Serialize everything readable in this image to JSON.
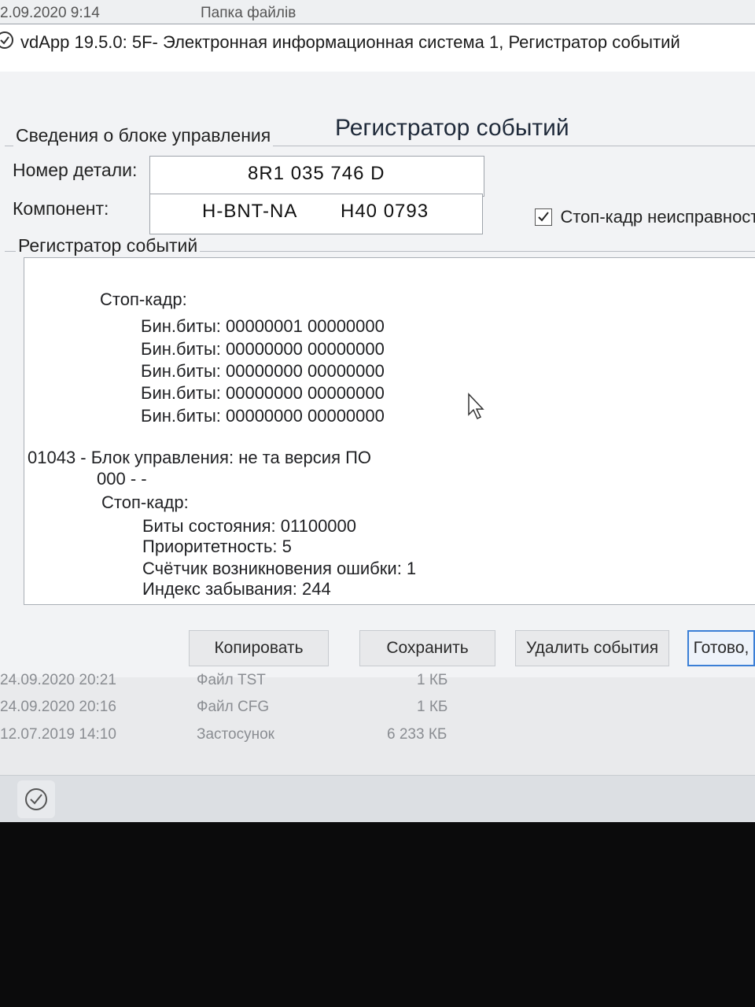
{
  "background": {
    "top_date": "2.09.2020 9:14",
    "top_label": "Папка файлів",
    "rows": [
      {
        "date": "24.09.2020 20:21",
        "type": "Файл TST",
        "size": "1 КБ"
      },
      {
        "date": "24.09.2020 20:16",
        "type": "Файл CFG",
        "size": "1 КБ"
      },
      {
        "date": "12.07.2019 14:10",
        "type": "Застосунок",
        "size": "6 233 КБ"
      }
    ]
  },
  "window": {
    "title": "vdApp 19.5.0: 5F- Электронная информационная система 1,  Регистратор событий",
    "control_unit_group": "Сведения о блоке управления",
    "heading": "Регистратор событий",
    "part_number_label": "Номер детали:",
    "part_number_value": "8R1 035 746 D",
    "component_label": "Компонент:",
    "component_value_a": "H-BNT-NA",
    "component_value_b": "H40 0793",
    "freeze_frame_checkbox": "Стоп-кадр неисправност",
    "event_log_group": "Регистратор событий"
  },
  "log": {
    "freeze1_title": "Стоп-кадр:",
    "bin_lines": [
      "Бин.биты: 00000001 00000000",
      "Бин.биты: 00000000 00000000",
      "Бин.биты: 00000000 00000000",
      "Бин.биты: 00000000 00000000",
      "Бин.биты: 00000000 00000000"
    ],
    "fault_line": "01043 - Блок управления: не та версия ПО",
    "fault_sub": "000 - -",
    "freeze2_title": "Стоп-кадр:",
    "status_bits": "Биты состояния: 01100000",
    "priority": "Приоритетность: 5",
    "occurrence_counter": "Счётчик возникновения ошибки: 1",
    "forget_index": "Индекс забывания: 244"
  },
  "buttons": {
    "copy": "Копировать",
    "save": "Сохранить",
    "delete_events": "Удалить события",
    "done": "Готово,"
  }
}
